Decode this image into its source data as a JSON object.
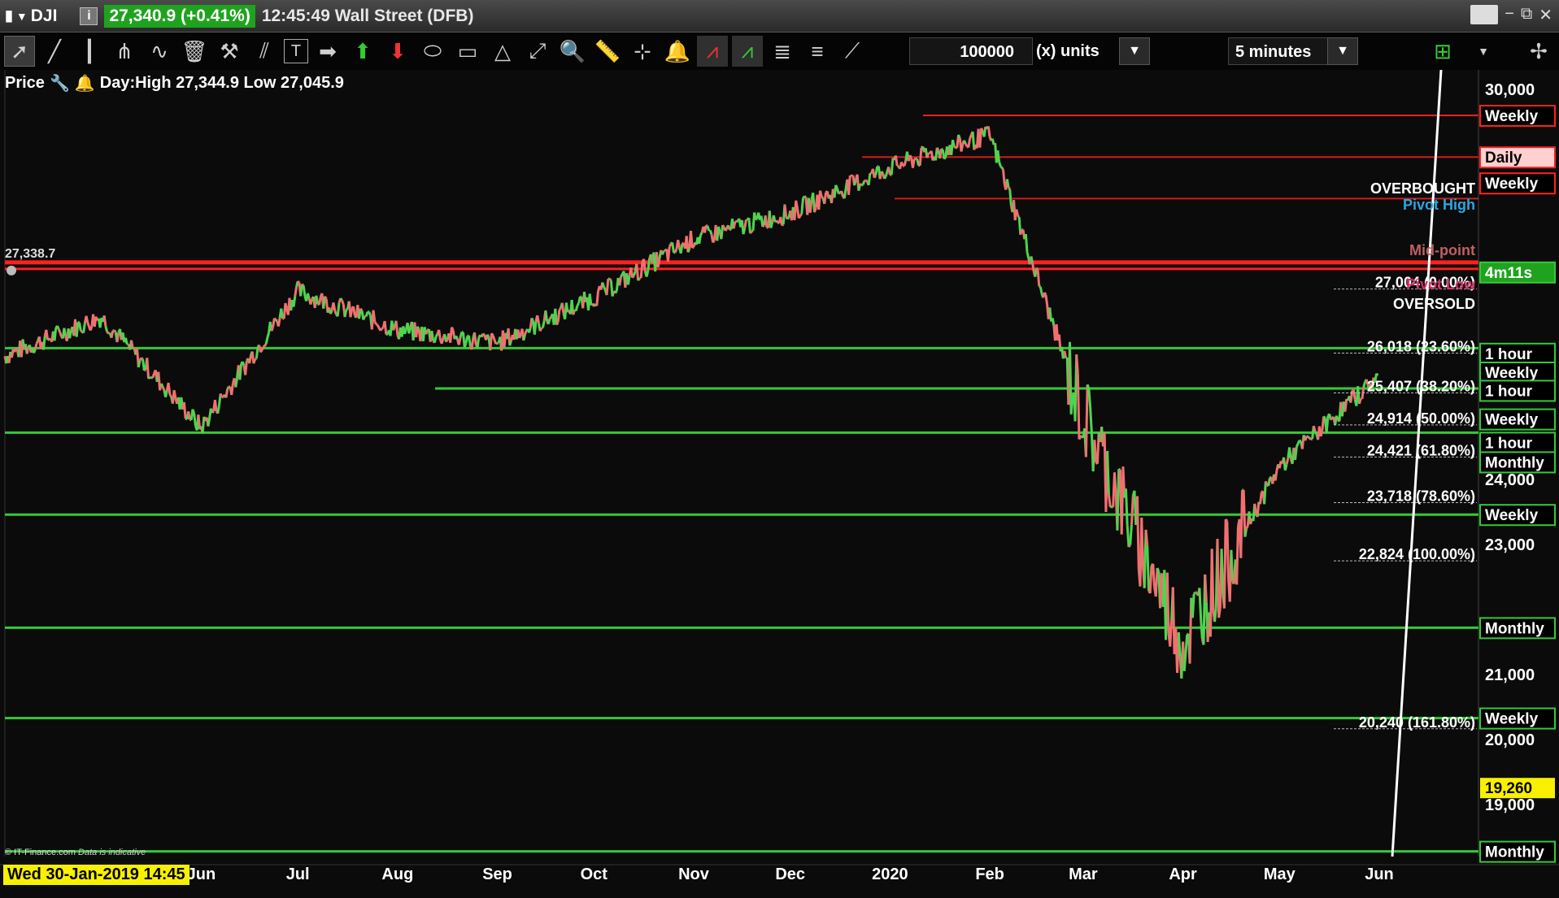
{
  "title": {
    "symbol": "DJI",
    "info_icon": "i",
    "quote": "27,340.9 (+0.41%)",
    "time": "12:45:49 Wall Street (DFB)"
  },
  "toolbar": {
    "units_value": "100000",
    "units_label": "(x) units",
    "interval": "5 minutes",
    "tools": [
      "pointer-icon",
      "line-icon",
      "vertical-line-icon",
      "fork-icon",
      "wave-icon",
      "trash-icon",
      "wrench-icon",
      "parallel-icon",
      "text-icon",
      "arrow-right-icon",
      "arrow-up-icon",
      "arrow-down-icon",
      "ellipse-icon",
      "rectangle-icon",
      "triangle-icon",
      "expand-icon",
      "zoom-icon",
      "ruler-icon",
      "crosshair-icon",
      "bell-icon",
      "indicator-icon",
      "indicator2-icon",
      "fib-icon",
      "fib2-icon",
      "trend-icon"
    ]
  },
  "infoline": {
    "price_label": "Price",
    "day_label": "Day:High 27,344.9 Low 27,045.9"
  },
  "colors": {
    "background": "#0b0b0b",
    "resistance": "#ff2020",
    "support": "#36c83a",
    "candle_up": "#4fd44f",
    "candle_down": "#f07070",
    "axis_text": "#ffffff",
    "current_price_bg": "#1fa31f",
    "cursor_bg": "#f7f000"
  },
  "cursor_date": "Wed 30-Jan-2019 14:45",
  "credit": {
    "site": "© IT-Finance.com",
    "note": "Data is indicative"
  },
  "chart_data": {
    "type": "line",
    "ylim": [
      18200,
      30300
    ],
    "y_ticks": [
      30000,
      24000,
      23000,
      21000,
      20000,
      19000
    ],
    "y_tick_labels": [
      "30,000",
      "24,000",
      "23,000",
      "21,000",
      "20,000",
      "19,000"
    ],
    "x_tick_labels": [
      "May",
      "Jun",
      "Jul",
      "Aug",
      "Sep",
      "Oct",
      "Nov",
      "Dec",
      "2020",
      "Feb",
      "Mar",
      "Apr",
      "May",
      "Jun"
    ],
    "x": [
      "2019-04-01",
      "2019-05-01",
      "2019-06-01",
      "2019-07-01",
      "2019-08-01",
      "2019-09-01",
      "2019-10-01",
      "2019-11-01",
      "2019-12-01",
      "2020-01-01",
      "2020-02-01",
      "2020-03-01",
      "2020-04-01",
      "2020-05-01",
      "2020-06-01"
    ],
    "values": [
      25900,
      26500,
      24800,
      26900,
      26300,
      26100,
      26800,
      27700,
      28100,
      28800,
      29300,
      25000,
      21500,
      24200,
      25600
    ],
    "horizontal_levels": [
      {
        "value": 29600,
        "color": "red",
        "label": "Weekly"
      },
      {
        "value": 28960,
        "color": "red",
        "label": "Daily"
      },
      {
        "value": 28320,
        "color": "red",
        "label": ""
      },
      {
        "value": 27338.7,
        "color": "red",
        "label": "27,338.7"
      },
      {
        "value": 26020,
        "color": "green",
        "label": "Weekly"
      },
      {
        "value": 25400,
        "color": "green",
        "label": ""
      },
      {
        "value": 24720,
        "color": "green",
        "label": "Monthly"
      },
      {
        "value": 23460,
        "color": "green",
        "label": "Weekly"
      },
      {
        "value": 21720,
        "color": "green",
        "label": "Monthly"
      },
      {
        "value": 20330,
        "color": "green",
        "label": "Weekly"
      },
      {
        "value": 18280,
        "color": "green",
        "label": "Monthly"
      }
    ],
    "fib_levels": [
      {
        "value": 27004,
        "label": "27,004 (0.00%)"
      },
      {
        "value": 26018,
        "label": "26,018 (23.60%)"
      },
      {
        "value": 25407,
        "label": "25,407 (38.20%)"
      },
      {
        "value": 24914,
        "label": "24,914 (50.00%)"
      },
      {
        "value": 24421,
        "label": "24,421 (61.80%)"
      },
      {
        "value": 23718,
        "label": "23,718 (78.60%)"
      },
      {
        "value": 22824,
        "label": "22,824 (100.00%)"
      },
      {
        "value": 20240,
        "label": "20,240 (161.80%)"
      }
    ],
    "right_labels": [
      {
        "value": 29600,
        "text": "Weekly",
        "style": "red"
      },
      {
        "value": 28960,
        "text": "Daily",
        "style": "red"
      },
      {
        "value": 28560,
        "text": "Weekly",
        "style": "red"
      },
      {
        "value": 27190,
        "text": "4m11s",
        "style": "green"
      },
      {
        "value": 25940,
        "text": "1 hour",
        "style": "green"
      },
      {
        "value": 25650,
        "text": "Weekly",
        "style": "green"
      },
      {
        "value": 25370,
        "text": "1 hour",
        "style": "green"
      },
      {
        "value": 24930,
        "text": "Weekly",
        "style": "green"
      },
      {
        "value": 24570,
        "text": "1 hour",
        "style": "green"
      },
      {
        "value": 24270,
        "text": "Monthly",
        "style": "green"
      },
      {
        "value": 23460,
        "text": "Weekly",
        "style": "green"
      },
      {
        "value": 21720,
        "text": "Monthly",
        "style": "green"
      },
      {
        "value": 20330,
        "text": "Weekly",
        "style": "green"
      },
      {
        "value": 19260,
        "text": "19,260",
        "style": "yellow"
      },
      {
        "value": 18280,
        "text": "Monthly",
        "style": "green"
      }
    ],
    "annotations": [
      "OVERBOUGHT",
      "Pivot High",
      "Mid-point",
      "Pivot Low",
      "OVERSOLD"
    ]
  }
}
